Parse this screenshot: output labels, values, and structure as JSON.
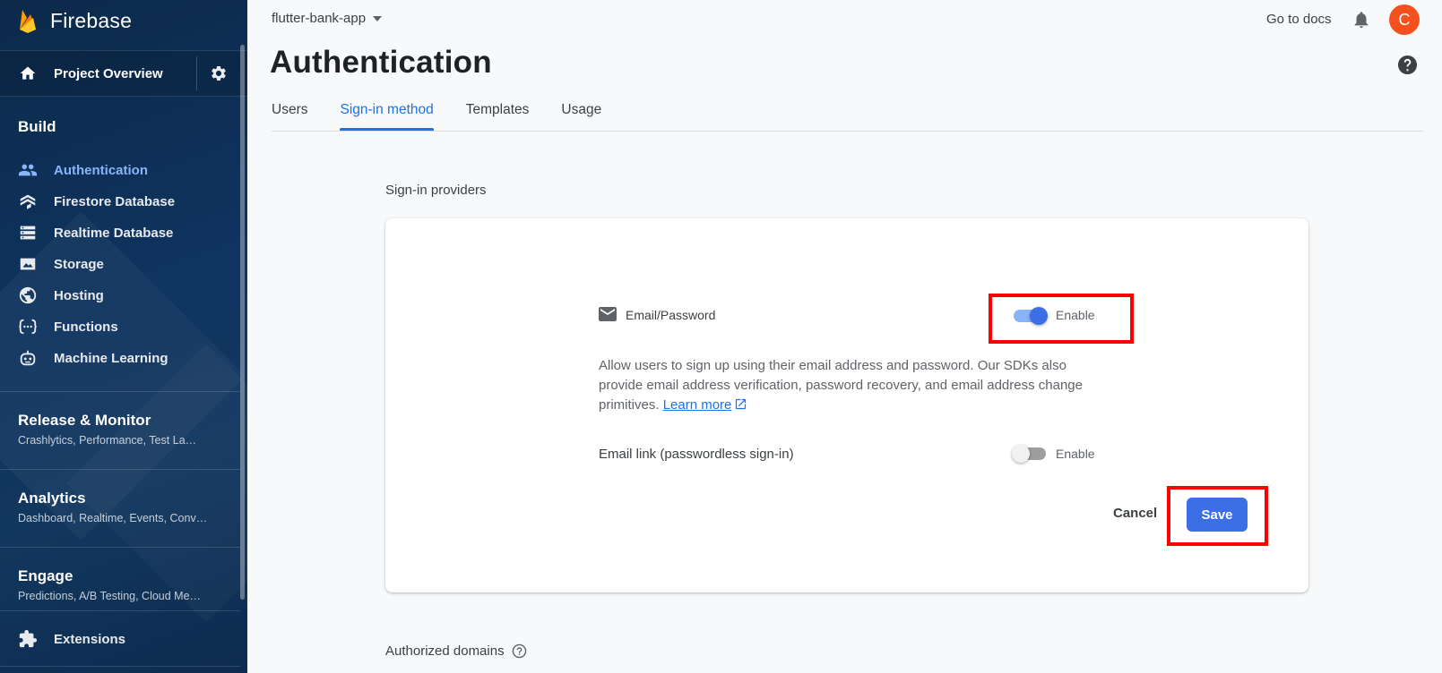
{
  "sidebar": {
    "brand": "Firebase",
    "overview_label": "Project Overview",
    "build_title": "Build",
    "build_items": [
      {
        "label": "Authentication",
        "icon": "people-icon"
      },
      {
        "label": "Firestore Database",
        "icon": "firestore-icon"
      },
      {
        "label": "Realtime Database",
        "icon": "database-icon"
      },
      {
        "label": "Storage",
        "icon": "image-icon"
      },
      {
        "label": "Hosting",
        "icon": "globe-icon"
      },
      {
        "label": "Functions",
        "icon": "functions-icon"
      },
      {
        "label": "Machine Learning",
        "icon": "robot-icon"
      }
    ],
    "active_item": "Authentication",
    "sections": [
      {
        "title": "Release & Monitor",
        "subtitle": "Crashlytics, Performance, Test La…"
      },
      {
        "title": "Analytics",
        "subtitle": "Dashboard, Realtime, Events, Conv…"
      },
      {
        "title": "Engage",
        "subtitle": "Predictions, A/B Testing, Cloud Me…"
      }
    ],
    "extensions_label": "Extensions"
  },
  "header": {
    "project": "flutter-bank-app",
    "docs_link": "Go to docs",
    "avatar_letter": "C",
    "page_title": "Authentication"
  },
  "tabs": [
    {
      "label": "Users"
    },
    {
      "label": "Sign-in method"
    },
    {
      "label": "Templates"
    },
    {
      "label": "Usage"
    }
  ],
  "active_tab": "Sign-in method",
  "providers": {
    "section_title": "Sign-in providers",
    "email_password": {
      "label": "Email/Password",
      "enable_label": "Enable",
      "enabled": true,
      "description": "Allow users to sign up using their email address and password. Our SDKs also provide email address verification, password recovery, and email address change primitives.",
      "learn_more": "Learn more"
    },
    "email_link": {
      "label": "Email link (passwordless sign-in)",
      "enable_label": "Enable",
      "enabled": false
    },
    "cancel_label": "Cancel",
    "save_label": "Save"
  },
  "authorized_domains": {
    "title": "Authorized domains"
  },
  "colors": {
    "sidebar_bg": "#0f3460",
    "accent": "#1a73e8",
    "save_button": "#3c6ee6",
    "highlight_box": "#ff0000",
    "avatar": "#f4511e"
  }
}
